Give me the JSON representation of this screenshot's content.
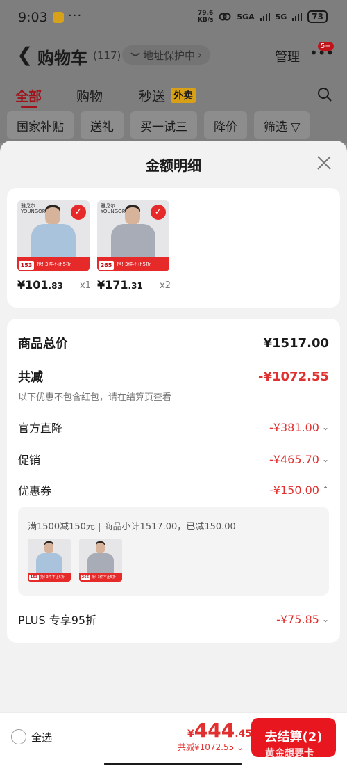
{
  "status_bar": {
    "time": "9:03",
    "dots": "···",
    "net_speed_value": "79.6",
    "net_speed_unit": "KB/s",
    "signal_1": "5GA",
    "signal_2": "5G",
    "battery": "73"
  },
  "cart_header": {
    "title": "购物车",
    "count": "(117)",
    "address_protect": "地址保护中",
    "address_chevron": "›",
    "manage": "管理",
    "more_badge": "5+"
  },
  "tabs": [
    {
      "label": "全部",
      "active": true
    },
    {
      "label": "购物",
      "active": false
    },
    {
      "label": "秒送",
      "active": false,
      "badge": "外卖"
    }
  ],
  "filter_chips": [
    "国家补贴",
    "送礼",
    "买一试三",
    "降价",
    "筛选 ▽"
  ],
  "sheet": {
    "title": "金额明细",
    "products": [
      {
        "brand": "雅戈尔",
        "brand_en": "YOUNGOR",
        "check": "✓",
        "promo_price": "153",
        "promo_text": "抢! 3件不止5折",
        "price_int": "¥101",
        "price_dec": ".83",
        "qty": "x1",
        "shirt_color": "#a9c3dd"
      },
      {
        "brand": "雅戈尔",
        "brand_en": "YOUNGOR",
        "check": "✓",
        "promo_price": "265",
        "promo_text": "抢! 3件不止5折",
        "price_int": "¥171",
        "price_dec": ".31",
        "qty": "x2",
        "shirt_color": "#a8acb6"
      }
    ],
    "total_label": "商品总价",
    "total_value": "¥1517.00",
    "reduce_label": "共减",
    "reduce_value": "-¥1072.55",
    "reduce_note": "以下优惠不包含红包，请在结算页查看",
    "items": [
      {
        "label": "官方直降",
        "value": "-¥381.00",
        "chevron": "⌄"
      },
      {
        "label": "促销",
        "value": "-¥465.70",
        "chevron": "⌄"
      },
      {
        "label": "优惠券",
        "value": "-¥150.00",
        "chevron": "⌃"
      }
    ],
    "coupon_detail": "满1500减150元 | 商品小计1517.00，已减150.00",
    "plus_label": "PLUS 专享95折",
    "plus_value": "-¥75.85",
    "plus_chevron": "⌄"
  },
  "bottom_bar": {
    "select_all": "全选",
    "total_yen": "¥",
    "total_int": "444",
    "total_dec": ".45",
    "savings": "共减¥1072.55 ⌄",
    "checkout_label": "去结算(2)",
    "checkout_sub": "黄金想要卡"
  }
}
